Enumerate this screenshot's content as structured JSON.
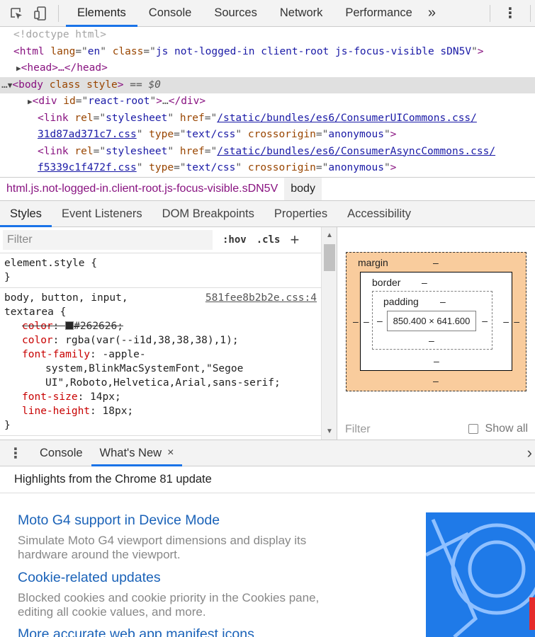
{
  "toolbar": {
    "tabs": [
      "Elements",
      "Console",
      "Sources",
      "Network",
      "Performance"
    ],
    "more_tabs": "»",
    "menu": "⋮"
  },
  "dom": {
    "doctype": "<!doctype html>",
    "html_open": {
      "tag": "html",
      "lang": "en",
      "class": "js not-logged-in client-root js-focus-visible sDN5V"
    },
    "head_collapsed": "<head>…</head>",
    "body_open": {
      "tag": "body",
      "class_attr": "class",
      "style_attr": "style",
      "marker": "== $0"
    },
    "div": {
      "id": "react-root",
      "ellipsis": "…"
    },
    "links": [
      {
        "rel": "stylesheet",
        "href_part1": "/static/bundles/es6/ConsumerUICommons.css/",
        "href_part2": "31d87ad371c7.css",
        "type": "text/css",
        "crossorigin": "anonymous"
      },
      {
        "rel": "stylesheet",
        "href_part1": "/static/bundles/es6/ConsumerAsyncCommons.css/",
        "href_part2": "f5339c1f472f.css",
        "type": "text/css",
        "crossorigin": "anonymous"
      }
    ]
  },
  "breadcrumbs": [
    "html.js.not-logged-in.client-root.js-focus-visible.sDN5V",
    "body"
  ],
  "subtabs": [
    "Styles",
    "Event Listeners",
    "DOM Breakpoints",
    "Properties",
    "Accessibility"
  ],
  "styles": {
    "filter_placeholder": "Filter",
    "hov": ":hov",
    "cls": ".cls",
    "add": "+",
    "element_style": "element.style {",
    "close_brace": "}",
    "rule": {
      "selector_line1": "body, button, input,",
      "selector_line2": "textarea {",
      "source": "581fee8b2b2e.css:4",
      "overridden_prop": "color",
      "overridden_value": "#262626",
      "color_value": "rgba(var(--i1d,38,38,38),1);",
      "font_family_line1": "-apple-",
      "font_family_line2": "system,BlinkMacSystemFont,\"Segoe",
      "font_family_line3": "UI\",Roboto,Helvetica,Arial,sans-serif;",
      "font_size": "14px;",
      "line_height": "18px;"
    }
  },
  "box_model": {
    "margin_label": "margin",
    "border_label": "border",
    "padding_label": "padding",
    "dash": "–",
    "content_size": "850.400 × 641.600",
    "filter": "Filter",
    "show_all": "Show all"
  },
  "drawer": {
    "tabs": [
      "Console",
      "What's New"
    ],
    "close": "×",
    "chevron": "›",
    "heading": "Highlights from the Chrome 81 update",
    "items": [
      {
        "title": "Moto G4 support in Device Mode",
        "desc_line1": "Simulate Moto G4 viewport dimensions and display its",
        "desc_line2": "hardware around the viewport."
      },
      {
        "title": "Cookie-related updates",
        "desc_line1": "Blocked cookies and cookie priority in the Cookies pane,",
        "desc_line2": "editing all cookie values, and more."
      },
      {
        "title": "More accurate web app manifest icons"
      }
    ]
  },
  "colors": {
    "accent": "#1a73e8",
    "tag": "#881280",
    "attr": "#994500",
    "value": "#1a1aa6",
    "margin_box": "#f9cc9d",
    "link_title": "#1a62b8"
  }
}
